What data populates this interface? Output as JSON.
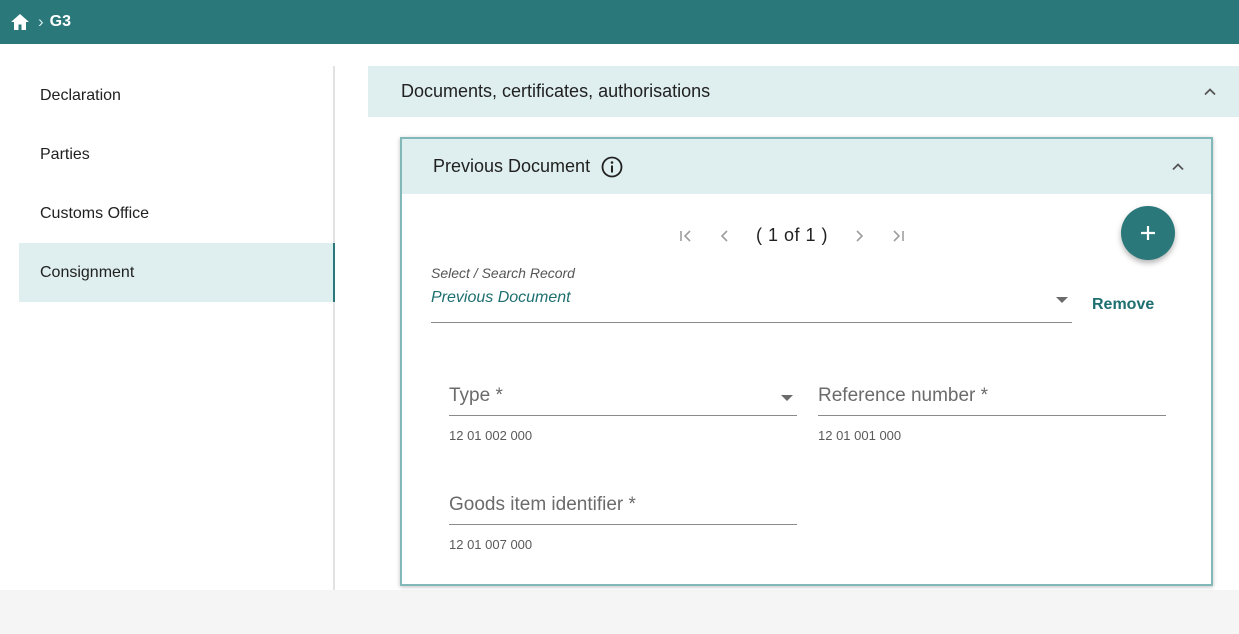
{
  "breadcrumb": {
    "current": "G3"
  },
  "sidebar": {
    "items": [
      {
        "label": "Declaration"
      },
      {
        "label": "Parties"
      },
      {
        "label": "Customs Office"
      },
      {
        "label": "Consignment"
      }
    ],
    "active": "Consignment"
  },
  "section": {
    "title": "Documents, certificates, authorisations"
  },
  "card": {
    "title": "Previous Document",
    "pager": {
      "count": "( 1 of 1 )"
    },
    "select": {
      "label": "Select / Search Record",
      "value": "Previous Document"
    },
    "remove_label": "Remove",
    "fields": {
      "type": {
        "label": "Type *",
        "hint": "12 01 002 000"
      },
      "reference": {
        "label": "Reference number *",
        "hint": "12 01 001 000"
      },
      "goods": {
        "label": "Goods item identifier *",
        "hint": "12 01 007 000"
      }
    }
  },
  "colors": {
    "brand": "#2a787a",
    "header_bg": "#dfeeee",
    "link": "#1e6f70"
  },
  "icons": [
    "home-icon",
    "chevron-right-icon",
    "chevron-up-icon",
    "info-icon",
    "first-page-icon",
    "previous-page-icon",
    "next-page-icon",
    "last-page-icon",
    "plus-icon",
    "dropdown-arrow-icon"
  ]
}
